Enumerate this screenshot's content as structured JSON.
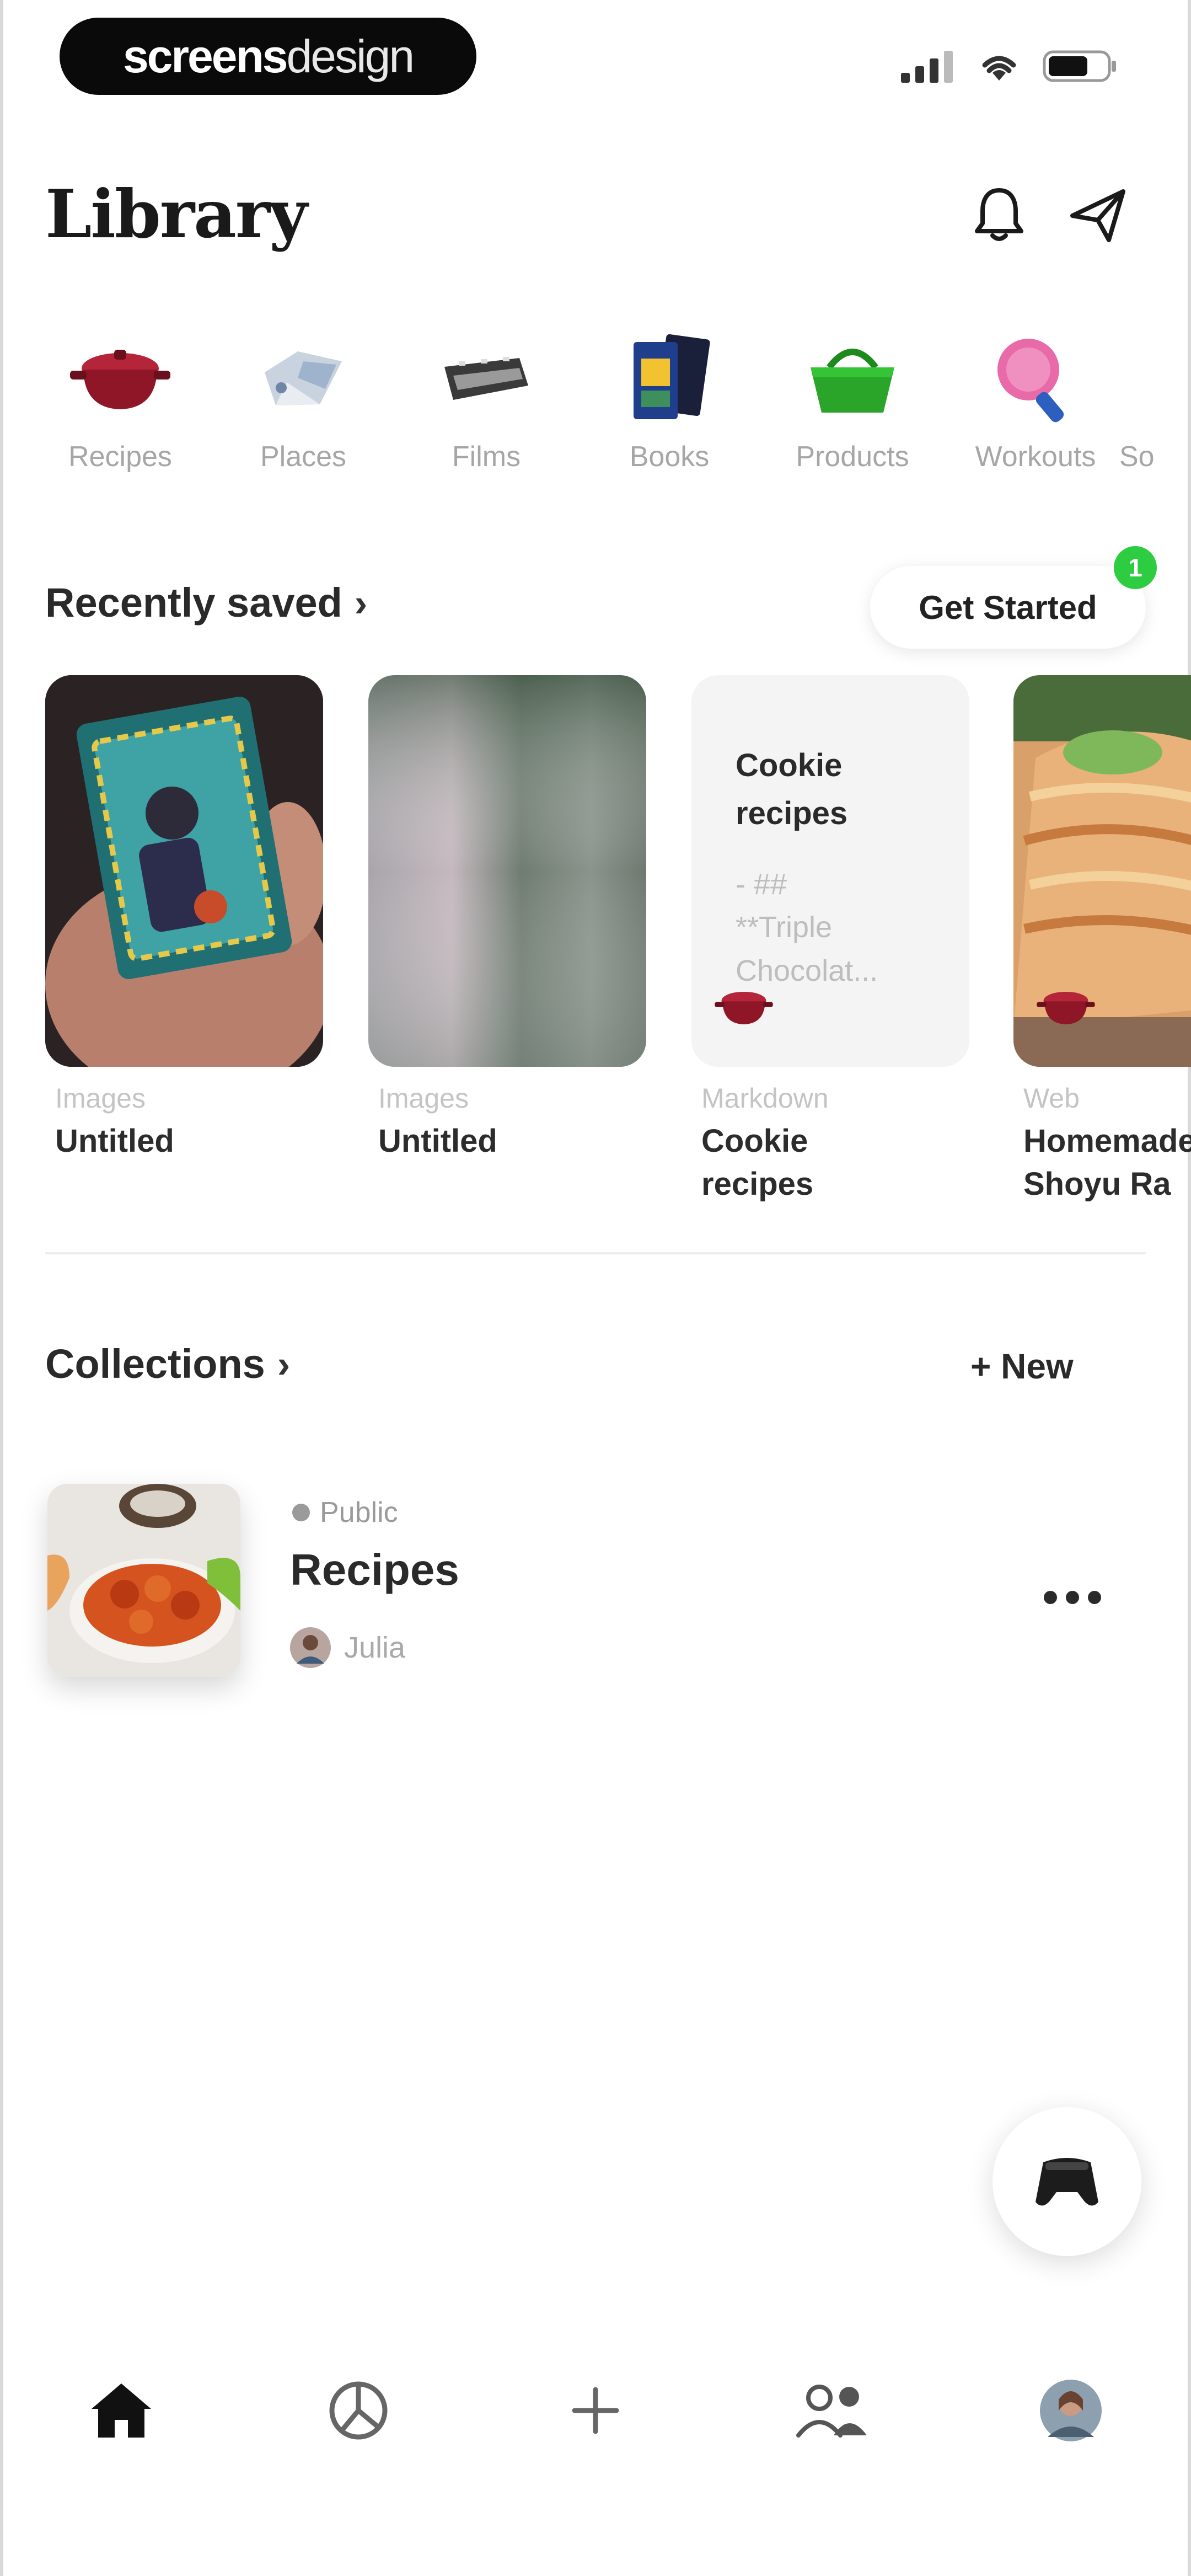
{
  "status_bar": {
    "brand_bold": "screens",
    "brand_light": "design"
  },
  "header": {
    "title": "Library",
    "notification_icon": "bell-icon",
    "share_icon": "paper-plane-icon"
  },
  "categories": [
    {
      "label": "Recipes",
      "icon": "pot-icon"
    },
    {
      "label": "Places",
      "icon": "map-icon"
    },
    {
      "label": "Films",
      "icon": "film-icon"
    },
    {
      "label": "Books",
      "icon": "books-icon"
    },
    {
      "label": "Products",
      "icon": "basket-icon"
    },
    {
      "label": "Workouts",
      "icon": "racket-icon"
    },
    {
      "label": "So",
      "icon": "music-icon"
    }
  ],
  "recently_saved": {
    "title": "Recently saved",
    "get_started_label": "Get Started",
    "badge_count": "1",
    "items": [
      {
        "type": "Images",
        "title": "Untitled"
      },
      {
        "type": "Images",
        "title": "Untitled"
      },
      {
        "type": "Markdown",
        "title": "Cookie recipes",
        "preview_title": "Cookie recipes",
        "preview_line1": "- ##",
        "preview_line2": "**Triple",
        "preview_line3": "Chocolat..."
      },
      {
        "type": "Web",
        "title": "Homemade Shoyu Ra"
      }
    ]
  },
  "collections": {
    "title": "Collections",
    "new_label": "+ New",
    "items": [
      {
        "visibility": "Public",
        "name": "Recipes",
        "owner": "Julia"
      }
    ]
  },
  "tabbar": [
    {
      "name": "home",
      "icon": "home-icon"
    },
    {
      "name": "explore",
      "icon": "compass-icon"
    },
    {
      "name": "add",
      "icon": "plus-icon"
    },
    {
      "name": "friends",
      "icon": "people-icon"
    },
    {
      "name": "profile",
      "icon": "avatar-icon"
    }
  ],
  "colors": {
    "accent_green": "#2ecc40",
    "pot_red": "#9b1c2a",
    "basket_green": "#2aa52a",
    "text_dark": "#1b1b1b",
    "text_muted": "#a6a6a6"
  }
}
